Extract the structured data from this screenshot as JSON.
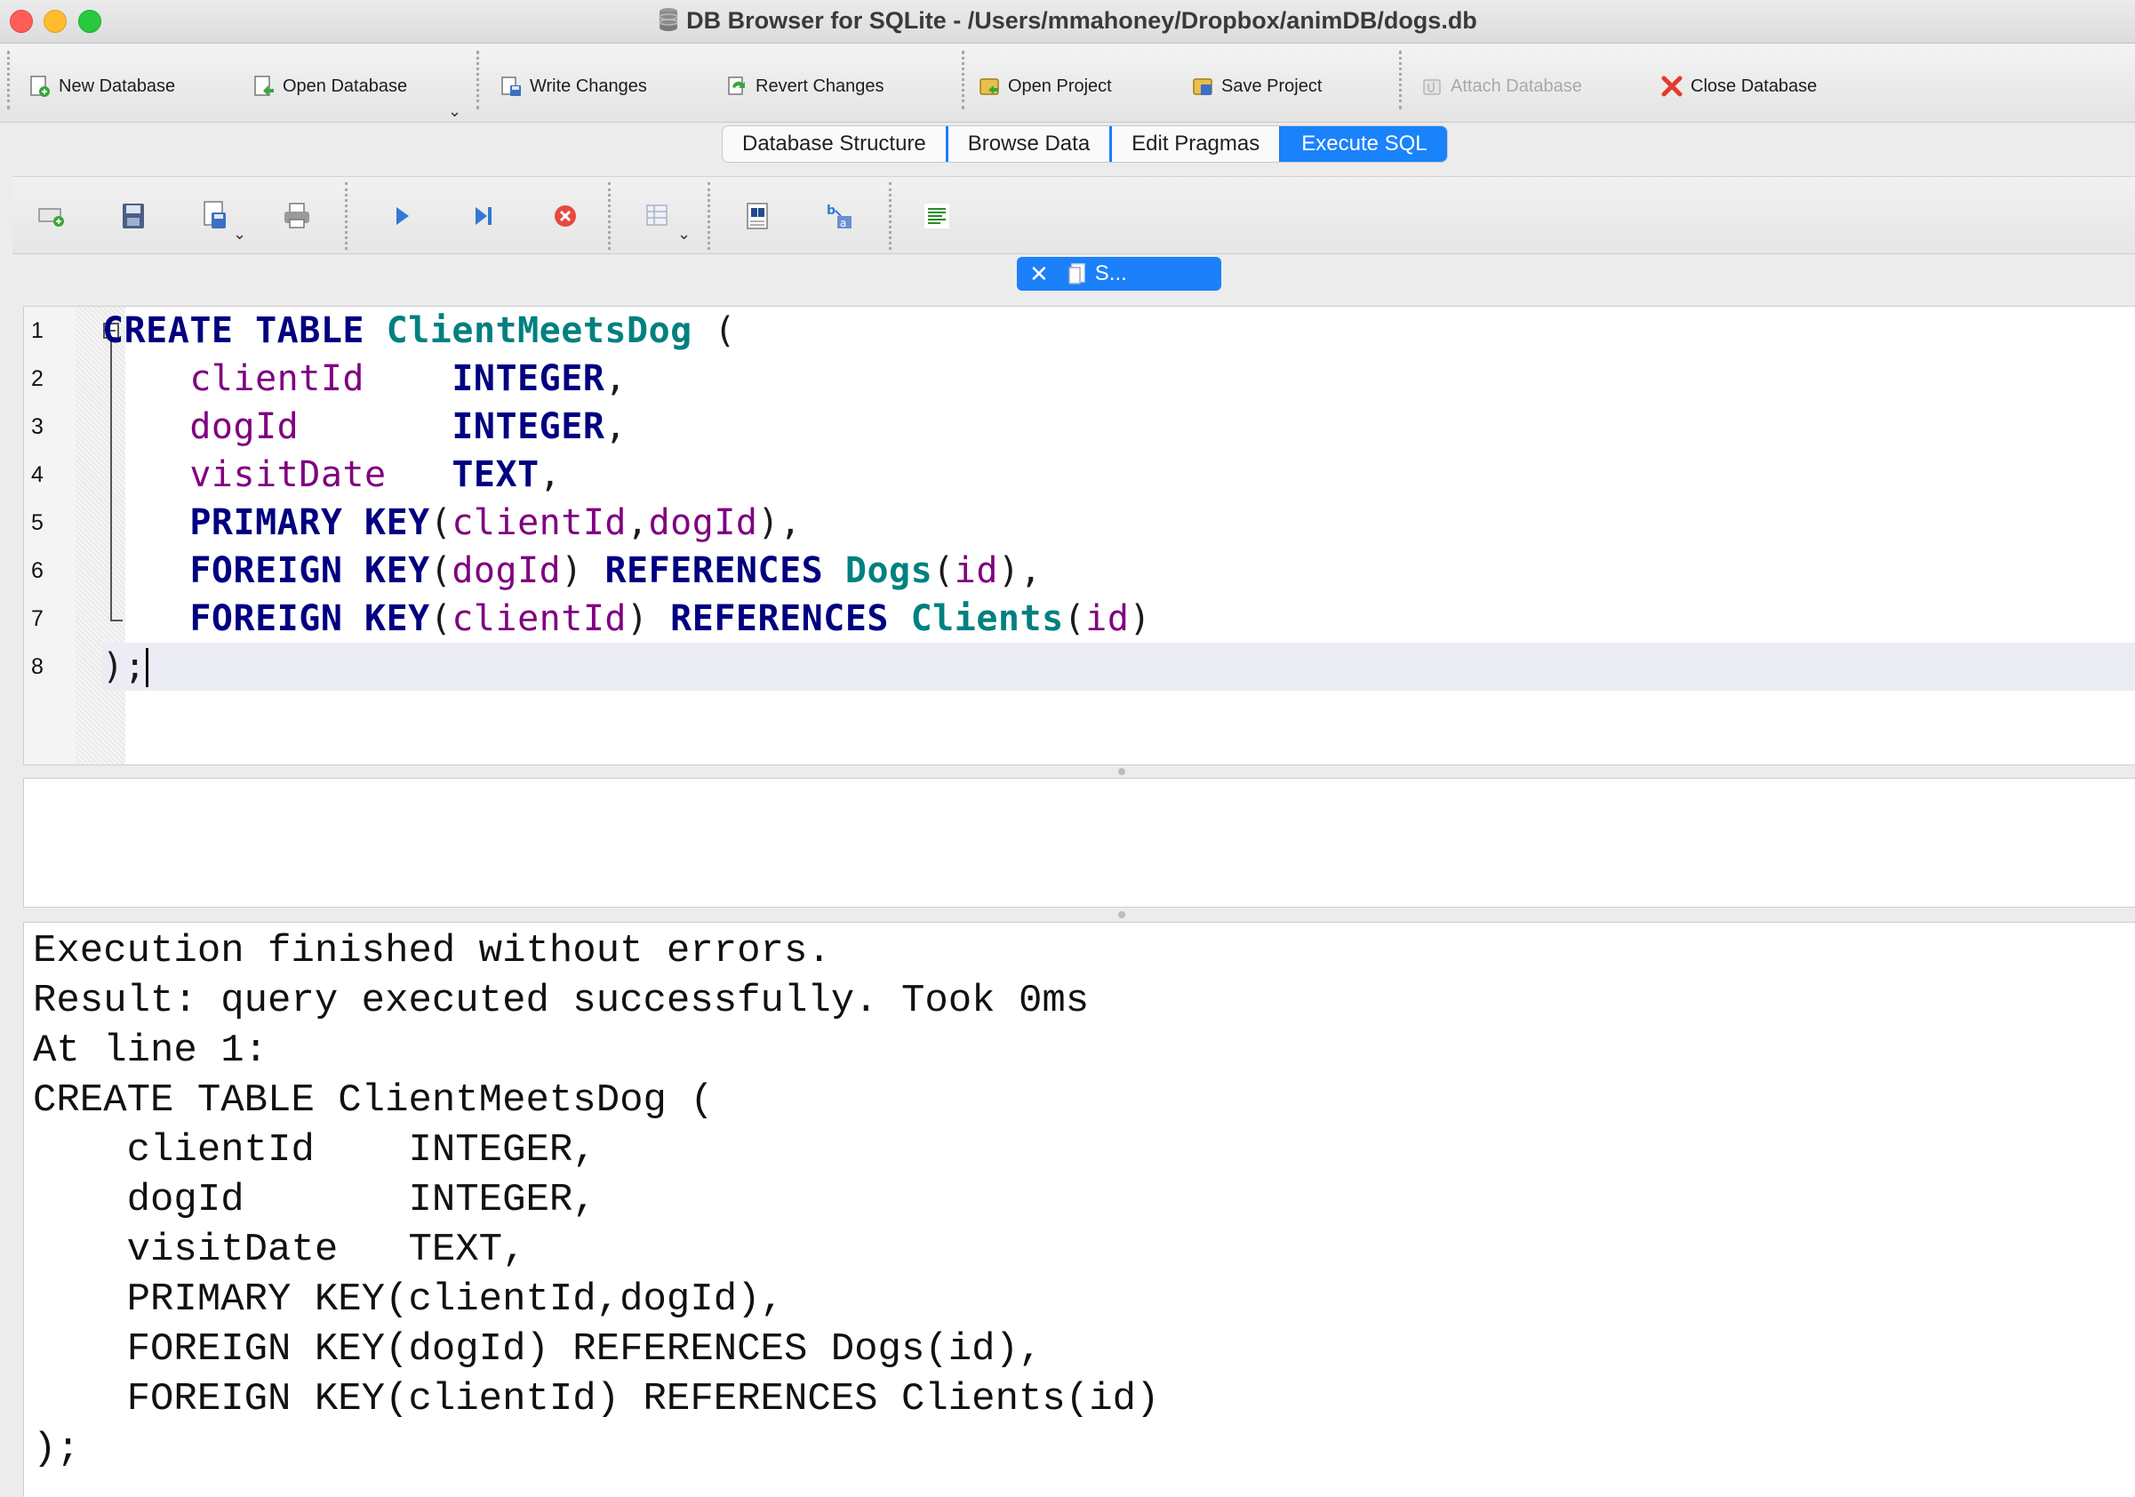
{
  "window": {
    "title": "DB Browser for SQLite - /Users/mmahoney/Dropbox/animDB/dogs.db"
  },
  "toolbar": {
    "new_database": "New Database",
    "open_database": "Open Database",
    "write_changes": "Write Changes",
    "revert_changes": "Revert Changes",
    "open_project": "Open Project",
    "save_project": "Save Project",
    "attach_database": "Attach Database",
    "close_database": "Close Database"
  },
  "tabs": [
    {
      "label": "Database Structure",
      "active": false
    },
    {
      "label": "Browse Data",
      "active": false
    },
    {
      "label": "Edit Pragmas",
      "active": false
    },
    {
      "label": "Execute SQL",
      "active": true
    }
  ],
  "editor_tab": {
    "label": "S..."
  },
  "editor": {
    "line_numbers": [
      "1",
      "2",
      "3",
      "4",
      "5",
      "6",
      "7",
      "8"
    ],
    "lines": [
      [
        {
          "t": "CREATE",
          "c": "kw"
        },
        {
          "t": " ",
          "c": "pun"
        },
        {
          "t": "TABLE",
          "c": "kw"
        },
        {
          "t": " ",
          "c": "pun"
        },
        {
          "t": "ClientMeetsDog",
          "c": "tbl"
        },
        {
          "t": " (",
          "c": "pun"
        }
      ],
      [
        {
          "t": "    ",
          "c": "pun"
        },
        {
          "t": "clientId",
          "c": "col"
        },
        {
          "t": "    ",
          "c": "pun"
        },
        {
          "t": "INTEGER",
          "c": "kw"
        },
        {
          "t": ",",
          "c": "pun"
        }
      ],
      [
        {
          "t": "    ",
          "c": "pun"
        },
        {
          "t": "dogId",
          "c": "col"
        },
        {
          "t": "       ",
          "c": "pun"
        },
        {
          "t": "INTEGER",
          "c": "kw"
        },
        {
          "t": ",",
          "c": "pun"
        }
      ],
      [
        {
          "t": "    ",
          "c": "pun"
        },
        {
          "t": "visitDate",
          "c": "col"
        },
        {
          "t": "   ",
          "c": "pun"
        },
        {
          "t": "TEXT",
          "c": "kw"
        },
        {
          "t": ",",
          "c": "pun"
        }
      ],
      [
        {
          "t": "    ",
          "c": "pun"
        },
        {
          "t": "PRIMARY",
          "c": "kw"
        },
        {
          "t": " ",
          "c": "pun"
        },
        {
          "t": "KEY",
          "c": "kw"
        },
        {
          "t": "(",
          "c": "pun"
        },
        {
          "t": "clientId",
          "c": "col"
        },
        {
          "t": ",",
          "c": "pun"
        },
        {
          "t": "dogId",
          "c": "col"
        },
        {
          "t": "),",
          "c": "pun"
        }
      ],
      [
        {
          "t": "    ",
          "c": "pun"
        },
        {
          "t": "FOREIGN",
          "c": "kw"
        },
        {
          "t": " ",
          "c": "pun"
        },
        {
          "t": "KEY",
          "c": "kw"
        },
        {
          "t": "(",
          "c": "pun"
        },
        {
          "t": "dogId",
          "c": "col"
        },
        {
          "t": ") ",
          "c": "pun"
        },
        {
          "t": "REFERENCES",
          "c": "kw"
        },
        {
          "t": " ",
          "c": "pun"
        },
        {
          "t": "Dogs",
          "c": "tbl"
        },
        {
          "t": "(",
          "c": "pun"
        },
        {
          "t": "id",
          "c": "col"
        },
        {
          "t": "),",
          "c": "pun"
        }
      ],
      [
        {
          "t": "    ",
          "c": "pun"
        },
        {
          "t": "FOREIGN",
          "c": "kw"
        },
        {
          "t": " ",
          "c": "pun"
        },
        {
          "t": "KEY",
          "c": "kw"
        },
        {
          "t": "(",
          "c": "pun"
        },
        {
          "t": "clientId",
          "c": "col"
        },
        {
          "t": ") ",
          "c": "pun"
        },
        {
          "t": "REFERENCES",
          "c": "kw"
        },
        {
          "t": " ",
          "c": "pun"
        },
        {
          "t": "Clients",
          "c": "tbl"
        },
        {
          "t": "(",
          "c": "pun"
        },
        {
          "t": "id",
          "c": "col"
        },
        {
          "t": ")",
          "c": "pun"
        }
      ],
      [
        {
          "t": ");",
          "c": "pun"
        }
      ]
    ]
  },
  "output": {
    "lines": [
      "Execution finished without errors.",
      "Result: query executed successfully. Took 0ms",
      "At line 1:",
      "CREATE TABLE ClientMeetsDog (",
      "    clientId    INTEGER,",
      "    dogId       INTEGER,",
      "    visitDate   TEXT,",
      "    PRIMARY KEY(clientId,dogId),",
      "    FOREIGN KEY(dogId) REFERENCES Dogs(id),",
      "    FOREIGN KEY(clientId) REFERENCES Clients(id)",
      ");"
    ]
  },
  "colors": {
    "keyword": "#000080",
    "table": "#008080",
    "column": "#800080",
    "active_tab": "#1a82fb"
  }
}
